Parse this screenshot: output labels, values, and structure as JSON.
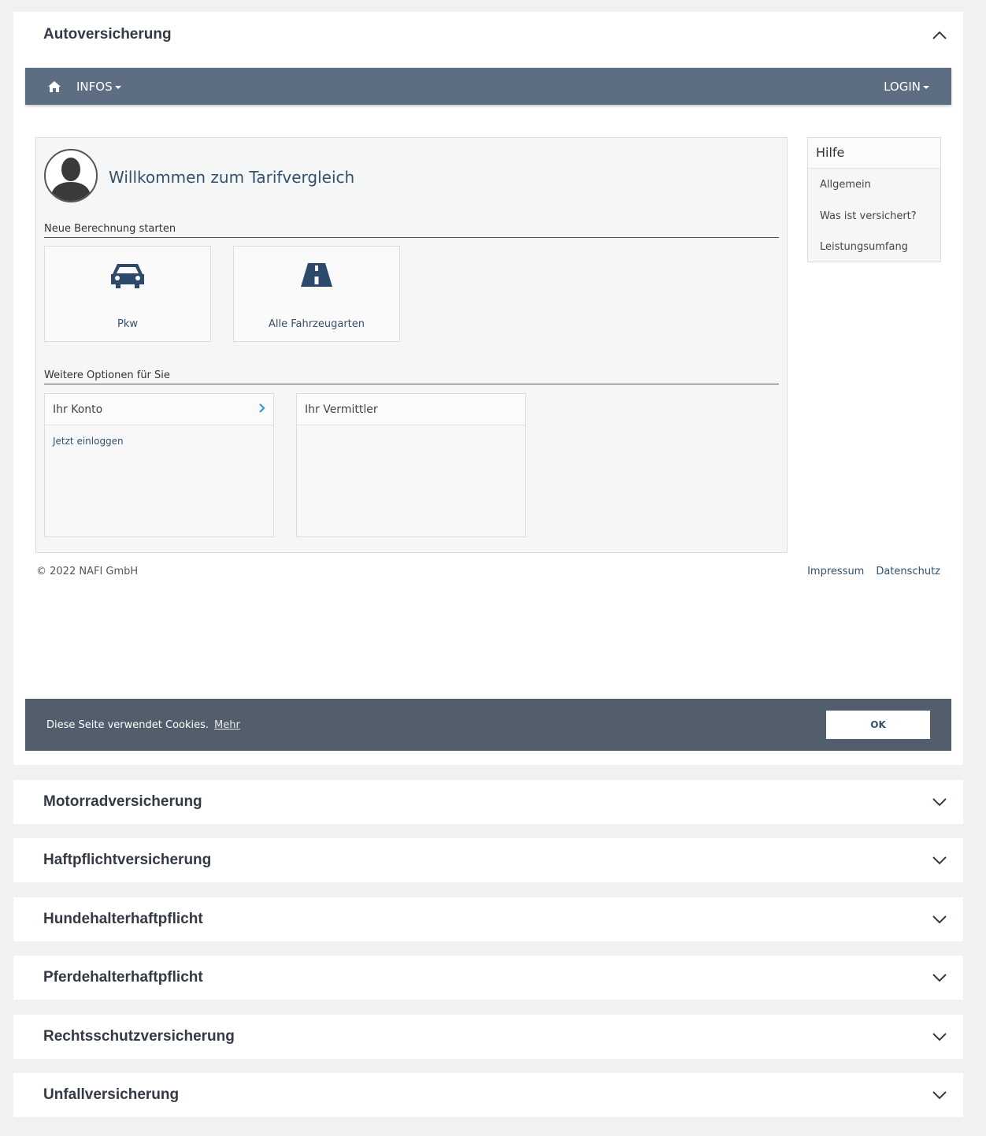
{
  "accordion": {
    "open": {
      "title": "Autoversicherung"
    },
    "closed": [
      {
        "title": "Motorradversicherung"
      },
      {
        "title": "Haftpflichtversicherung"
      },
      {
        "title": "Hundehalterhaftpflicht"
      },
      {
        "title": "Pferdehalterhaftpflicht"
      },
      {
        "title": "Rechtsschutzversicherung"
      },
      {
        "title": "Unfallversicherung"
      }
    ]
  },
  "navbar": {
    "infos_label": "INFOS",
    "login_label": "LOGIN",
    "color": "#5d6e83"
  },
  "main": {
    "welcome": "Willkommen zum Tarifvergleich",
    "section_new": "Neue Berechnung starten",
    "tiles": [
      {
        "label": "Pkw",
        "icon": "car-icon"
      },
      {
        "label": "Alle Fahrzeugarten",
        "icon": "road-icon"
      }
    ],
    "section_more": "Weitere Optionen für Sie",
    "cards": [
      {
        "title": "Ihr Konto",
        "link": "Jetzt einloggen"
      },
      {
        "title": "Ihr Vermittler"
      }
    ]
  },
  "help": {
    "title": "Hilfe",
    "items": [
      "Allgemein",
      "Was ist versichert?",
      "Leistungsumfang"
    ]
  },
  "footer": {
    "copyright": "© 2022 NAFI GmbH",
    "impressum": "Impressum",
    "datenschutz": "Datenschutz"
  },
  "cookie": {
    "text": "Diese Seite verwendet Cookies.",
    "more": "Mehr",
    "ok": "OK"
  },
  "colors": {
    "accent": "#34506e",
    "cookie_bg": "#535e6d",
    "chevron_blue": "#2a9fd6"
  }
}
